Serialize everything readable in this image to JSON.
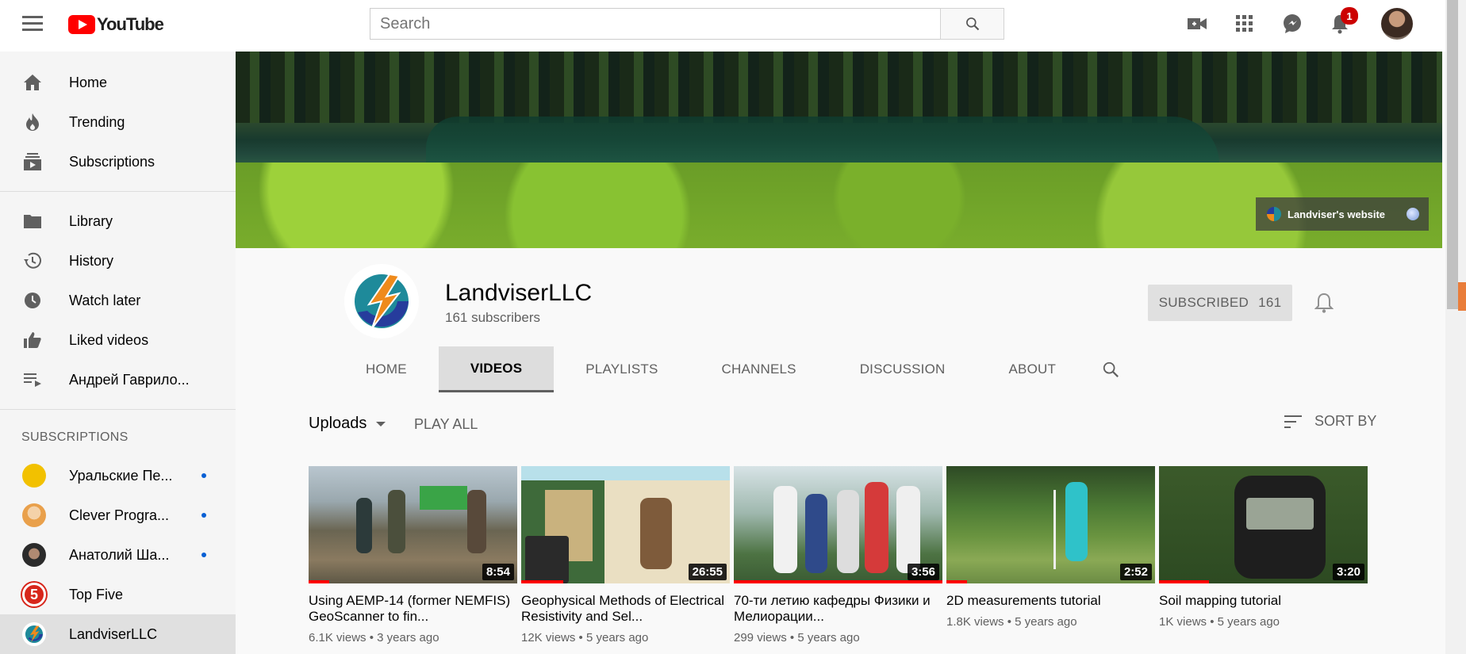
{
  "header": {
    "logo_text": "YouTube",
    "search_placeholder": "Search",
    "notification_count": "1"
  },
  "sidebar": {
    "items": [
      {
        "label": "Home",
        "icon": "home-icon"
      },
      {
        "label": "Trending",
        "icon": "trending-icon"
      },
      {
        "label": "Subscriptions",
        "icon": "subscriptions-icon"
      }
    ],
    "library_items": [
      {
        "label": "Library",
        "icon": "folder-icon"
      },
      {
        "label": "History",
        "icon": "history-icon"
      },
      {
        "label": "Watch later",
        "icon": "clock-icon"
      },
      {
        "label": "Liked videos",
        "icon": "thumb-up-icon"
      },
      {
        "label": "Андрей Гаврило...",
        "icon": "playlist-icon"
      }
    ],
    "subscriptions_heading": "SUBSCRIPTIONS",
    "subscriptions": [
      {
        "label": "Уральские Пе...",
        "new": true,
        "color": "#f2c100"
      },
      {
        "label": "Clever Progra...",
        "new": true,
        "color": "#e9a04b"
      },
      {
        "label": "Анатолий Ша...",
        "new": true,
        "color": "#2b2b2b"
      },
      {
        "label": "Top Five",
        "new": false,
        "color": "#d7261b"
      },
      {
        "label": "LandviserLLC",
        "new": false,
        "color": "#1e8a9a"
      }
    ]
  },
  "banner": {
    "link_label": "Landviser's website"
  },
  "channel": {
    "name": "LandviserLLC",
    "subscribers": "161 subscribers",
    "subscribe_label": "SUBSCRIBED",
    "subscribe_count": "161",
    "tabs": [
      "HOME",
      "VIDEOS",
      "PLAYLISTS",
      "CHANNELS",
      "DISCUSSION",
      "ABOUT"
    ],
    "active_tab": "VIDEOS"
  },
  "controls": {
    "uploads_label": "Uploads",
    "play_all_label": "PLAY ALL",
    "sort_label": "SORT BY"
  },
  "videos": [
    {
      "title": "Using AEMP-14 (former NEMFIS) GeoScanner to fin...",
      "duration": "8:54",
      "views": "6.1K views",
      "age": "3 years ago",
      "watched_fraction": 0.1
    },
    {
      "title": "Geophysical Methods of Electrical Resistivity and Sel...",
      "duration": "26:55",
      "views": "12K views",
      "age": "5 years ago",
      "watched_fraction": 0.2
    },
    {
      "title": "70-ти летию кафедры Физики и Мелиорации...",
      "duration": "3:56",
      "views": "299 views",
      "age": "5 years ago",
      "watched_fraction": 1.0
    },
    {
      "title": "2D measurements tutorial",
      "duration": "2:52",
      "views": "1.8K views",
      "age": "5 years ago",
      "watched_fraction": 0.1
    },
    {
      "title": "Soil mapping tutorial",
      "duration": "3:20",
      "views": "1K views",
      "age": "5 years ago",
      "watched_fraction": 0.24
    }
  ],
  "meta_separator": "•"
}
